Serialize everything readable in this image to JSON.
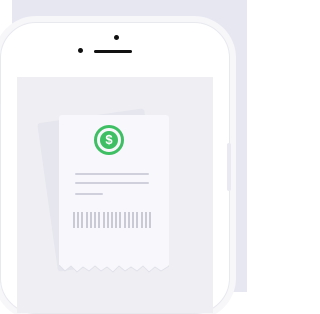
{
  "illustration": {
    "subject": "receipt",
    "icon": "dollar-icon",
    "dollar_symbol": "$",
    "accent_color": "#3fbf63"
  }
}
